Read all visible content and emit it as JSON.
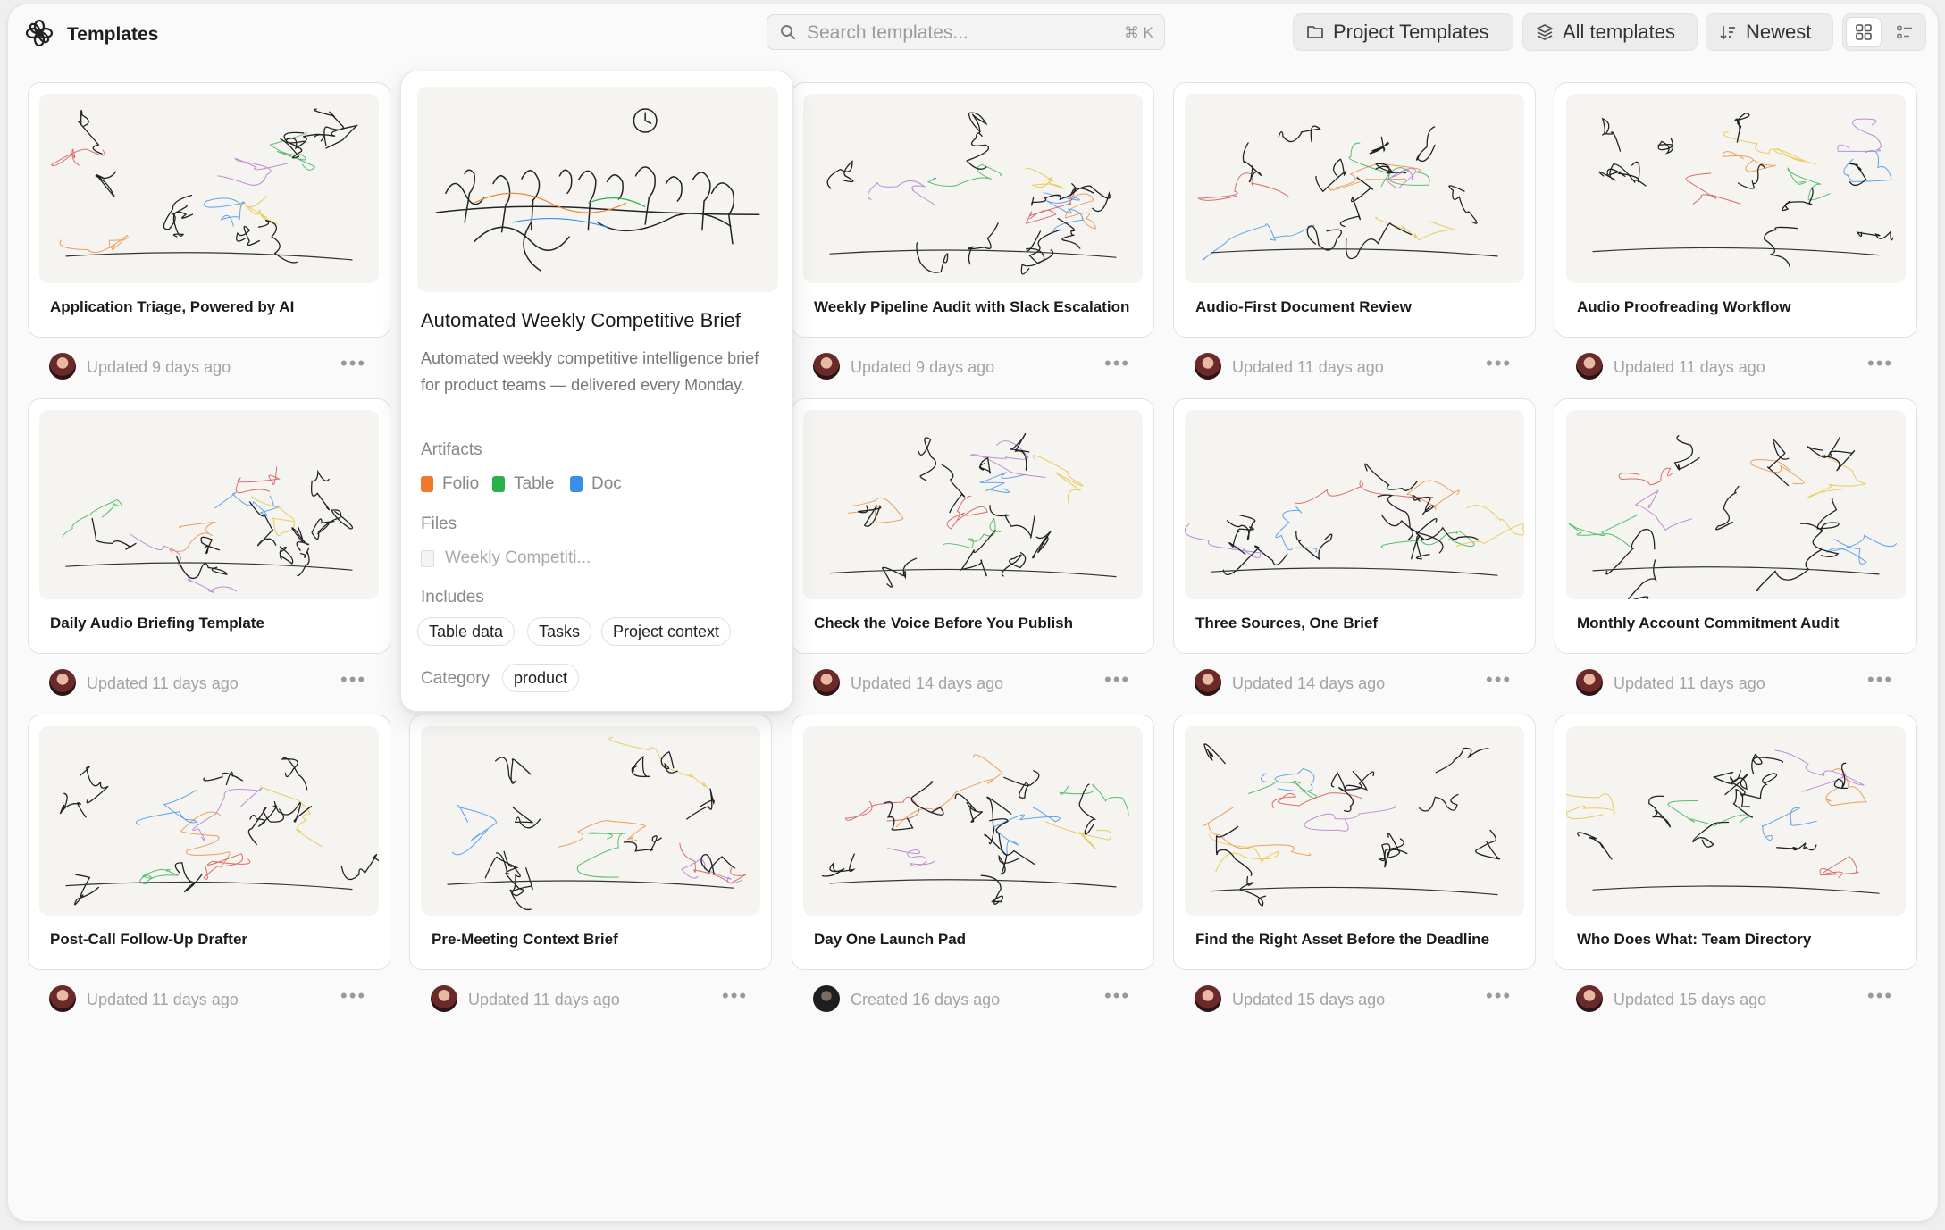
{
  "app": {
    "title": "Templates"
  },
  "search": {
    "placeholder": "Search templates...",
    "shortcut": "⌘ K"
  },
  "toolbar": {
    "project_templates": "Project Templates",
    "all_templates": "All templates",
    "sort": "Newest"
  },
  "cards": [
    {
      "title": "Application Triage, Powered by AI",
      "meta": "Updated 9 days ago"
    },
    {
      "title": "Automated Weekly Competitive Brief",
      "meta": ""
    },
    {
      "title": "Weekly Pipeline Audit with Slack Escalation",
      "meta": "Updated 9 days ago"
    },
    {
      "title": "Audio-First Document Review",
      "meta": "Updated 11 days ago"
    },
    {
      "title": "Audio Proofreading Workflow",
      "meta": "Updated 11 days ago"
    },
    {
      "title": "Daily Audio Briefing Template",
      "meta": "Updated 11 days ago"
    },
    {
      "title": "",
      "meta": ""
    },
    {
      "title": "Check the Voice Before You Publish",
      "meta": "Updated 14 days ago"
    },
    {
      "title": "Three Sources, One Brief",
      "meta": "Updated 14 days ago"
    },
    {
      "title": "Monthly Account Commitment Audit",
      "meta": "Updated 11 days ago"
    },
    {
      "title": "Post-Call Follow-Up Drafter",
      "meta": "Updated 11 days ago"
    },
    {
      "title": "Pre-Meeting Context Brief",
      "meta": "Updated 11 days ago"
    },
    {
      "title": "Day One Launch Pad",
      "meta": "Created 16 days ago"
    },
    {
      "title": "Find the Right Asset Before the Deadline",
      "meta": "Updated 15 days ago"
    },
    {
      "title": "Who Does What: Team Directory",
      "meta": "Updated 15 days ago"
    }
  ],
  "popover": {
    "title": "Automated Weekly Competitive Brief",
    "description": "Automated weekly competitive intelligence brief for product teams — delivered every Monday.",
    "artifacts_label": "Artifacts",
    "artifacts": [
      "Folio",
      "Table",
      "Doc"
    ],
    "files_label": "Files",
    "file": "Weekly Competiti...",
    "includes_label": "Includes",
    "includes": [
      "Table data",
      "Tasks",
      "Project context"
    ],
    "category_label": "Category",
    "category": "product"
  },
  "colors": {
    "folio": "#f07a2a",
    "table": "#2bb04a",
    "doc": "#3a8ee6"
  }
}
